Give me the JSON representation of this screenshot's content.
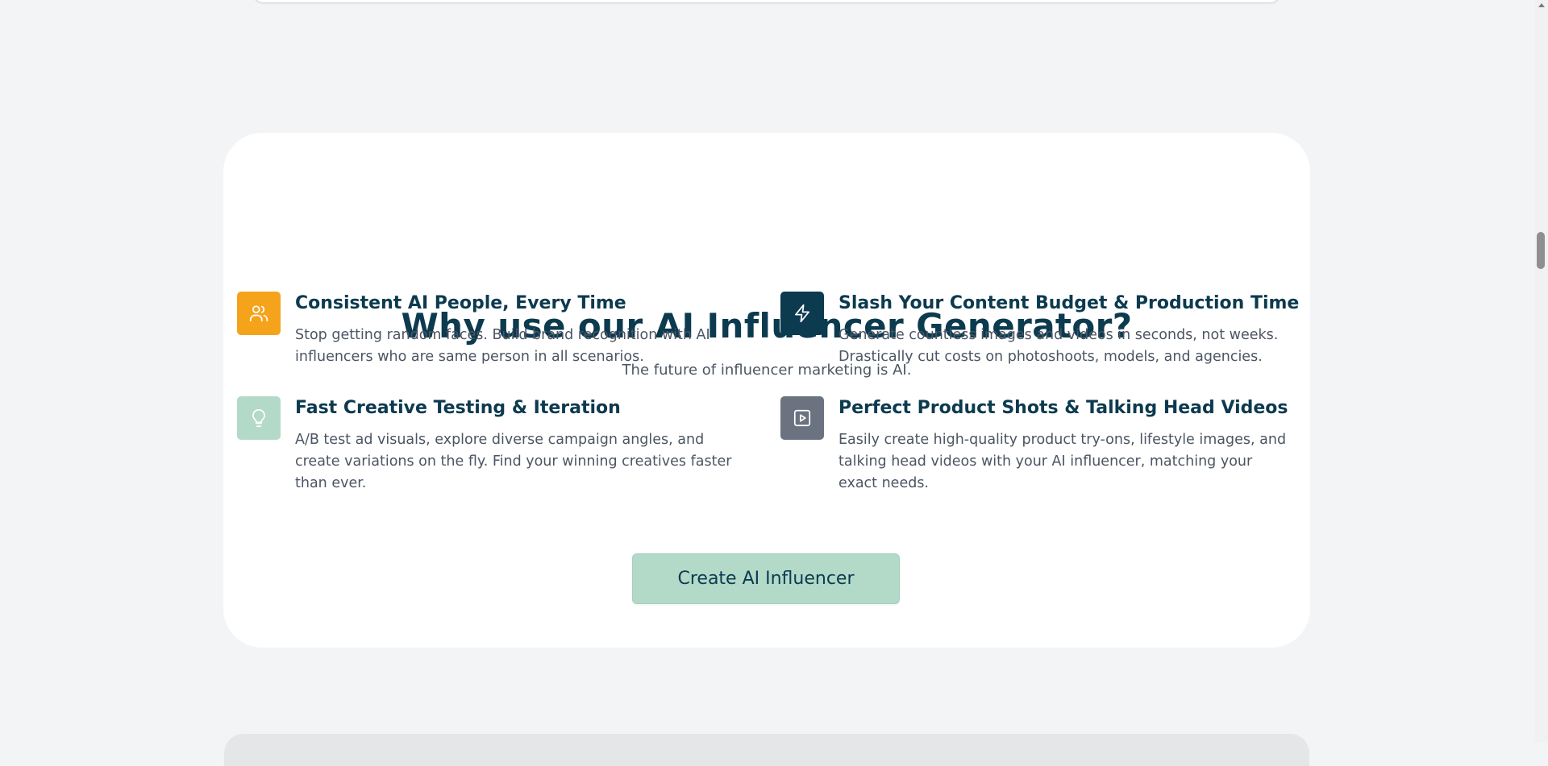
{
  "section": {
    "title": "Why use our AI Influencer Generator?",
    "subtitle": "The future of influencer marketing is AI."
  },
  "features": [
    {
      "title": "Consistent AI People, Every Time",
      "description": "Stop getting random faces. Build brand recognition with AI influencers who are same person in all scenarios.",
      "icon": "users-icon",
      "icon_bg": "#f5a31b"
    },
    {
      "title": "Slash Your Content Budget & Production Time",
      "description": "Generate countless images and videos in seconds, not weeks. Drastically cut costs on photoshoots, models, and agencies.",
      "icon": "lightning-icon",
      "icon_bg": "#0c3a4f"
    },
    {
      "title": "Fast Creative Testing & Iteration",
      "description": "A/B test ad visuals, explore diverse campaign angles, and create variations on the fly. Find your winning creatives faster than ever.",
      "icon": "lightbulb-icon",
      "icon_bg": "#b3d9c9"
    },
    {
      "title": "Perfect Product Shots & Talking Head Videos",
      "description": "Easily create high-quality product try-ons, lifestyle images, and talking head videos with your AI influencer, matching your exact needs.",
      "icon": "play-square-icon",
      "icon_bg": "#6b7280"
    }
  ],
  "cta": {
    "label": "Create AI Influencer",
    "bg": "#b3d9c9"
  },
  "colors": {
    "page_bg": "#f3f4f6",
    "heading": "#0c3a4f",
    "body_text": "#4b5563"
  }
}
